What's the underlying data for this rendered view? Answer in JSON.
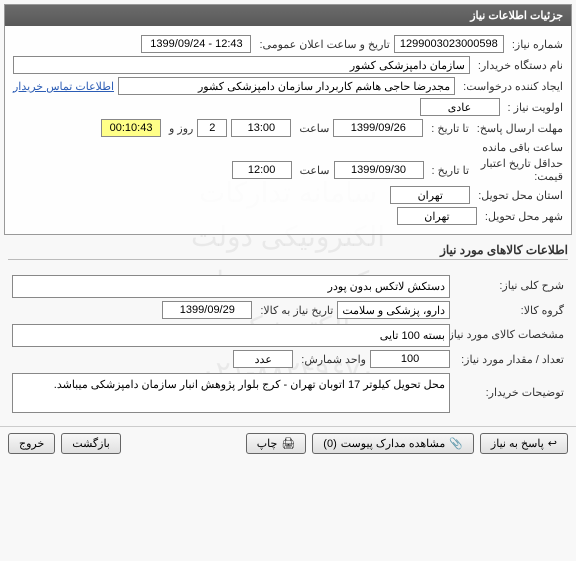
{
  "watermark_line1": "سامانه تدارکات الکترونیکی دولت",
  "watermark_line2": "مرکز توسعه تجارت الکترونیکی",
  "watermark_line3": "۰۲۱-۸۸۲۴۹۶۷۰",
  "panel1": {
    "title": "جزئیات اطلاعات نیاز",
    "rows": {
      "req_no_label": "شماره نیاز:",
      "req_no": "1299003023000598",
      "announce_label": "تاریخ و ساعت اعلان عمومی:",
      "announce_val": "12:43 - 1399/09/24",
      "buyer_label": "نام دستگاه خریدار:",
      "buyer_val": "سازمان دامپزشکی کشور",
      "creator_label": "ایجاد کننده درخواست:",
      "creator_val": "مجدرضا حاجی هاشم کاربردار سازمان دامپزشکی کشور",
      "contact_link": "اطلاعات تماس خریدار",
      "priority_label": "اولویت نیاز :",
      "priority_val": "عادی",
      "deadline_label": "مهلت ارسال پاسخ:",
      "to_date_label": "تا تاریخ :",
      "date1": "1399/09/26",
      "time_label": "ساعت",
      "time1": "13:00",
      "days": "2",
      "days_label": "روز و",
      "remain_time": "00:10:43",
      "remain_label": "ساعت باقی مانده",
      "min_credit_label": "حداقل تاریخ اعتبار",
      "price_label": "قیمت:",
      "to_date2_label": "تا تاریخ :",
      "date2": "1399/09/30",
      "time2": "12:00",
      "province_label": "استان محل تحویل:",
      "province_val": "تهران",
      "city_label": "شهر محل تحویل:",
      "city_val": "تهران"
    }
  },
  "panel2": {
    "title": "اطلاعات کالاهای مورد نیاز",
    "desc_label": "شرح کلی نیاز:",
    "desc_val": "دستکش لاتکس بدون پودر",
    "group_label": "گروه کالا:",
    "group_val": "دارو، پزشکی و سلامت",
    "need_date_label": "تاریخ نیاز به کالا:",
    "need_date_val": "1399/09/29",
    "spec_label": "مشخصات کالای مورد نیاز:",
    "spec_val": "بسته 100 تایی",
    "qty_label": "تعداد / مقدار مورد نیاز:",
    "qty_val": "100",
    "unit_label": "واحد شمارش:",
    "unit_val": "عدد",
    "notes_label": "توضیحات خریدار:",
    "notes_val": "محل تحویل کیلوتر 17 اتوبان تهران - کرج بلوار پژوهش انبار سازمان دامپزشکی میباشد."
  },
  "footer": {
    "respond": "پاسخ به نیاز",
    "view_docs": "مشاهده مدارک پیوست",
    "doc_count": "(0)",
    "print": "چاپ",
    "back": "بازگشت",
    "exit": "خروج"
  }
}
